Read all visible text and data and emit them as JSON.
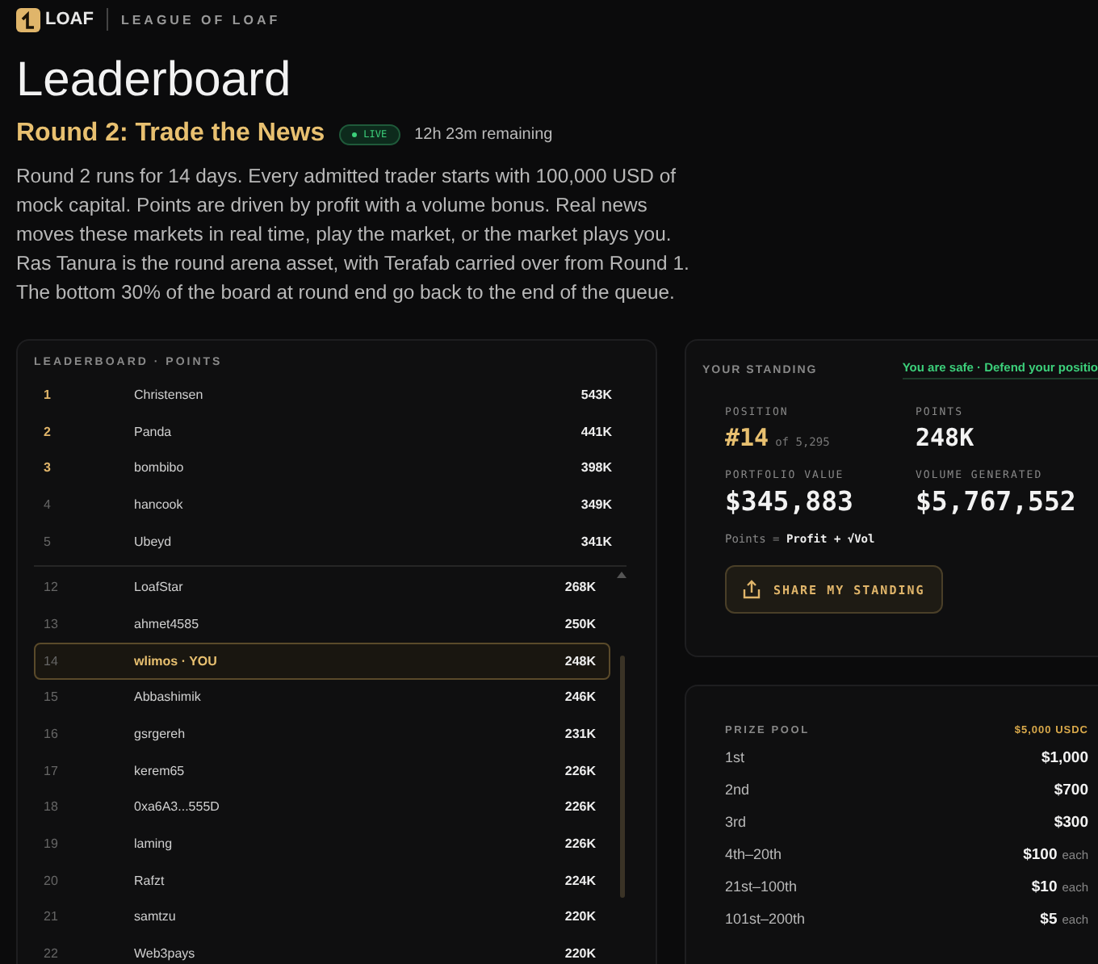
{
  "brand": {
    "logo_text": "LOAF",
    "tagline": "LEAGUE OF LOAF"
  },
  "title": "Leaderboard",
  "round": {
    "title": "Round 2: Trade the News",
    "status": "LIVE",
    "live": true,
    "remaining": "12h 23m remaining"
  },
  "description": "Round 2 runs for 14 days. Every admitted trader starts with 100,000 USD of mock capital. Points are driven by profit with a volume bonus.  Real news moves these markets in real time, play the market, or the market plays you. Ras Tanura is the round arena asset, with Terafab carried over from Round 1. The bottom 30% of the board at round end go back to the end of the queue.",
  "leaderboard": {
    "heading": "LEADERBOARD · POINTS",
    "top_rows": [
      {
        "rank": "1",
        "name": "Christensen",
        "points": "543K",
        "medal": true,
        "selected": false
      },
      {
        "rank": "2",
        "name": "Panda",
        "points": "441K",
        "medal": true,
        "selected": false
      },
      {
        "rank": "3",
        "name": "bombibo",
        "points": "398K",
        "medal": true,
        "selected": false
      },
      {
        "rank": "4",
        "name": "hancook",
        "points": "349K",
        "medal": false,
        "selected": false
      },
      {
        "rank": "5",
        "name": "Ubeyd",
        "points": "341K",
        "medal": false,
        "selected": false
      }
    ],
    "rows": [
      {
        "rank": "12",
        "name": "LoafStar",
        "points": "268K",
        "medal": false,
        "selected": false
      },
      {
        "rank": "13",
        "name": "ahmet4585",
        "points": "250K",
        "medal": false,
        "selected": false
      },
      {
        "rank": "14",
        "name": "wlimos · YOU",
        "points": "248K",
        "medal": false,
        "selected": true
      },
      {
        "rank": "15",
        "name": "Abbashimik",
        "points": "246K",
        "medal": false,
        "selected": false
      },
      {
        "rank": "16",
        "name": "gsrgereh",
        "points": "231K",
        "medal": false,
        "selected": false
      },
      {
        "rank": "17",
        "name": "kerem65",
        "points": "226K",
        "medal": false,
        "selected": false
      },
      {
        "rank": "18",
        "name": "0xa6A3...555D",
        "points": "226K",
        "medal": false,
        "selected": false
      },
      {
        "rank": "19",
        "name": "laming",
        "points": "226K",
        "medal": false,
        "selected": false
      },
      {
        "rank": "20",
        "name": "Rafzt",
        "points": "224K",
        "medal": false,
        "selected": false
      },
      {
        "rank": "21",
        "name": "samtzu",
        "points": "220K",
        "medal": false,
        "selected": false
      },
      {
        "rank": "22",
        "name": "Web3pays",
        "points": "220K",
        "medal": false,
        "selected": false
      }
    ]
  },
  "standing": {
    "heading": "YOUR STANDING",
    "status": "You are safe · Defend your positio",
    "position_label": "POSITION",
    "position": "#14",
    "position_of": "of 5,295",
    "points_label": "POINTS",
    "points": "248K",
    "portfolio_label": "PORTFOLIO VALUE",
    "portfolio": "$345,883",
    "volume_label": "VOLUME GENERATED",
    "volume": "$5,767,552",
    "formula": "Points = **Profit + √Vol**",
    "share_button": "SHARE MY STANDING"
  },
  "prize_pool": {
    "heading": "PRIZE POOL",
    "total": "$5,000 USDC",
    "rows": [
      {
        "place": "1st",
        "amount": "$1,000"
      },
      {
        "place": "2nd",
        "amount": "$700"
      },
      {
        "place": "3rd",
        "amount": "$300"
      },
      {
        "place": "4th–20th",
        "amount": "$100",
        "unit": "each"
      },
      {
        "place": "21st–100th",
        "amount": "$10",
        "unit": "each"
      },
      {
        "place": "101st–200th",
        "amount": "$5",
        "unit": "each"
      }
    ]
  }
}
